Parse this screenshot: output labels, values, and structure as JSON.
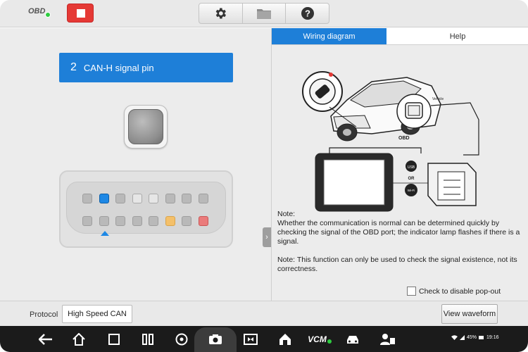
{
  "header": {
    "obd_label": "OBD",
    "obd_status_color": "#2ecc40",
    "stop_icon": "stop-icon",
    "tools": [
      {
        "icon": "gear-icon"
      },
      {
        "icon": "folder-icon"
      },
      {
        "icon": "help-icon"
      }
    ]
  },
  "left": {
    "pin_number": "2",
    "pin_title": "CAN-H signal pin",
    "connector": {
      "top_row": [
        "gray",
        "active",
        "gray",
        "white",
        "white",
        "gray",
        "gray",
        "gray"
      ],
      "bottom_row": [
        "gray",
        "gray",
        "gray",
        "gray",
        "gray",
        "yellow",
        "gray",
        "red"
      ],
      "selected_pin": 2
    }
  },
  "right": {
    "tabs": [
      {
        "label": "Wiring diagram",
        "active": true
      },
      {
        "label": "Help",
        "active": false
      }
    ],
    "diagram": {
      "obd_label": "OBD",
      "vehicle_label": "Vehicle",
      "usb_label": "USB",
      "or_label": "OR",
      "wifi_label": "Wi-Fi"
    },
    "note1_title": "Note:",
    "note1_body": "Whether the communication is normal can be determined quickly by checking the signal of the OBD port; the indicator lamp flashes if there is a signal.",
    "note2": "Note: This function can only be used to check the signal existence, not its correctness.",
    "popout_label": "Check to disable pop-out"
  },
  "footer": {
    "protocol_label": "Protocol",
    "protocol_value": "High Speed CAN",
    "waveform_button": "View waveform"
  },
  "navbar": {
    "icons": [
      "back-icon",
      "home-icon",
      "recents-icon",
      "split-icon",
      "browser-icon",
      "camera-icon",
      "screen-icon",
      "house-icon",
      "vcm-icon",
      "car-icon",
      "profile-icon"
    ],
    "vcm_label": "VCM",
    "battery": "45%",
    "time": "19:16"
  }
}
